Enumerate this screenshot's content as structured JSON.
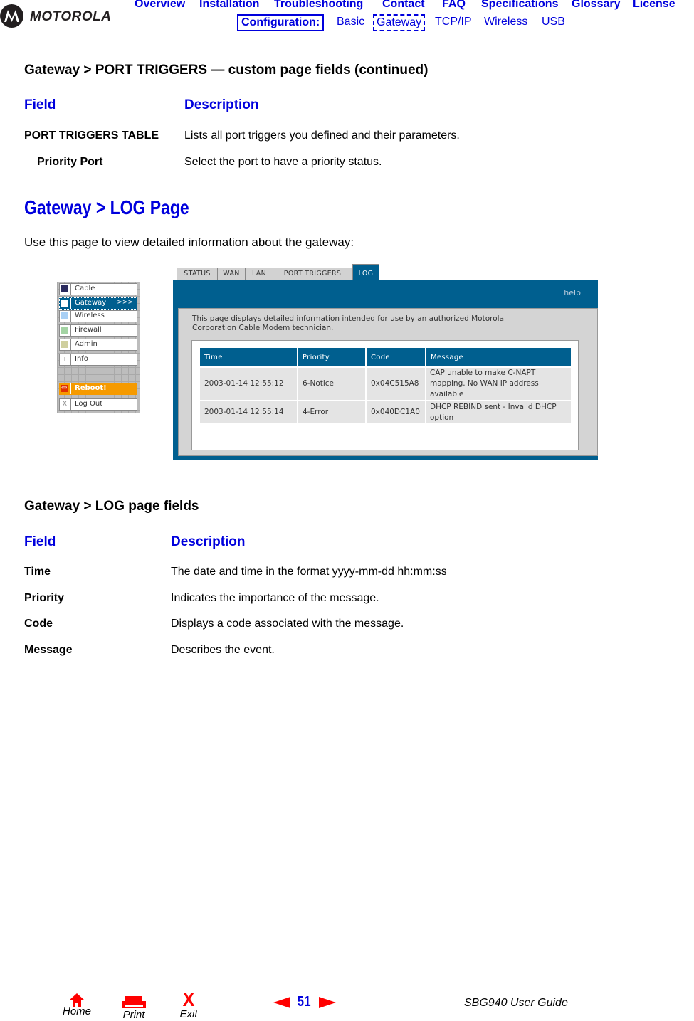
{
  "header": {
    "brand": "MOTOROLA",
    "nav_primary": [
      "Overview",
      "Installation",
      "Troubleshooting",
      "Contact",
      "FAQ",
      "Specifications",
      "Glossary",
      "License"
    ],
    "config_label": "Configuration:",
    "nav_secondary": [
      "Basic",
      "Gateway",
      "TCP/IP",
      "Wireless",
      "USB"
    ],
    "active_secondary": "Gateway"
  },
  "port_triggers": {
    "title": "Gateway > PORT TRIGGERS — custom page fields (continued)",
    "col_field": "Field",
    "col_desc": "Description",
    "rows": [
      {
        "field": "PORT TRIGGERS TABLE",
        "desc": "Lists all port triggers you defined and their parameters."
      },
      {
        "field": "Priority Port",
        "desc": "Select the port to have a priority status."
      }
    ]
  },
  "log_page": {
    "title": "Gateway > LOG Page",
    "intro": "Use this page to view detailed information about the gateway:"
  },
  "screenshot": {
    "sidebar": [
      {
        "label": "Cable",
        "icon": "square-icon",
        "color": "#2b2b5e"
      },
      {
        "label": "Gateway",
        "icon": "square-icon",
        "color": "#ffffff",
        "active": true,
        "suffix": ">>>"
      },
      {
        "label": "Wireless",
        "icon": "square-icon",
        "color": "#a9d0f5"
      },
      {
        "label": "Firewall",
        "icon": "square-icon",
        "color": "#a3d3a3"
      },
      {
        "label": "Admin",
        "icon": "square-icon",
        "color": "#cfcf9f"
      },
      {
        "label": "Info",
        "icon": "info-icon",
        "glyph": "i"
      },
      {
        "label": "Reboot!",
        "icon": "reboot-icon",
        "glyph": "⇦"
      },
      {
        "label": "Log Out",
        "icon": "logout-icon",
        "glyph": "X"
      }
    ],
    "tabs": [
      "STATUS",
      "WAN",
      "LAN",
      "PORT TRIGGERS",
      "LOG"
    ],
    "active_tab": "LOG",
    "help": "help",
    "description": "This page displays detailed information intended for use by an authorized Motorola Corporation Cable Modem technician.",
    "log_table": {
      "headers": [
        "Time",
        "Priority",
        "Code",
        "Message"
      ],
      "rows": [
        [
          "2003-01-14 12:55:12",
          "6-Notice",
          "0x04C515A8",
          "CAP unable to make C-NAPT mapping. No WAN IP address available"
        ],
        [
          "2003-01-14 12:55:14",
          "4-Error",
          "0x040DC1A0",
          "DHCP REBIND sent - Invalid DHCP option"
        ]
      ]
    }
  },
  "log_fields": {
    "title": "Gateway > LOG page fields",
    "col_field": "Field",
    "col_desc": "Description",
    "rows": [
      {
        "field": "Time",
        "desc": "The date and time in the format yyyy-mm-dd hh:mm:ss"
      },
      {
        "field": "Priority",
        "desc": "Indicates the importance of the message."
      },
      {
        "field": "Code",
        "desc": "Displays a code associated with the message."
      },
      {
        "field": "Message",
        "desc": "Describes the event."
      }
    ]
  },
  "footer": {
    "home": "Home",
    "print": "Print",
    "exit": "Exit",
    "page_number": "51",
    "guide_title": "SBG940 User Guide",
    "accent_red": "#ff0000",
    "accent_blue": "#0000dd"
  }
}
